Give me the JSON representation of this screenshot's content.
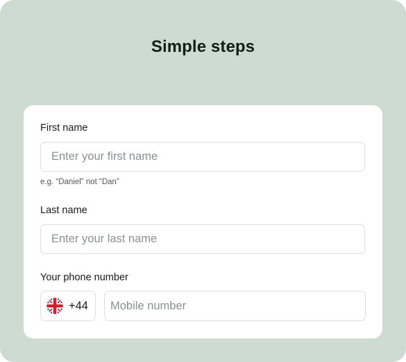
{
  "title": "Simple steps",
  "form": {
    "first_name": {
      "label": "First name",
      "placeholder": "Enter your first name",
      "value": "",
      "hint": "e.g. “Daniel” not “Dan”"
    },
    "last_name": {
      "label": "Last name",
      "placeholder": "Enter your last name",
      "value": ""
    },
    "phone": {
      "label": "Your phone number",
      "country_icon": "uk-flag-icon",
      "country_code": "+44",
      "placeholder": "Mobile number",
      "value": ""
    }
  },
  "colors": {
    "background": "#cddbd3",
    "card": "#ffffff",
    "title": "#0f1f17",
    "border": "#dcdfe1",
    "placeholder": "#8a8f94"
  }
}
